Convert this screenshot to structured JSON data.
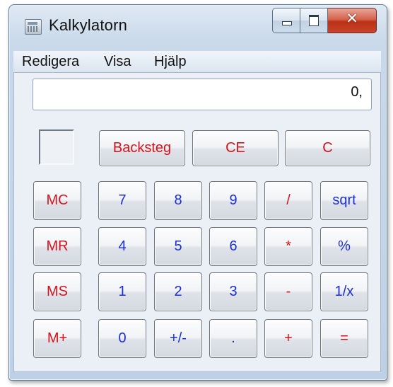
{
  "window": {
    "title": "Kalkylatorn"
  },
  "menu": [
    "Redigera",
    "Visa",
    "Hjälp"
  ],
  "display": {
    "value": "0,"
  },
  "buttons": {
    "backspace": "Backsteg",
    "ce": "CE",
    "c": "C",
    "mc": "MC",
    "mr": "MR",
    "ms": "MS",
    "mplus": "M+",
    "n7": "7",
    "n8": "8",
    "n9": "9",
    "n4": "4",
    "n5": "5",
    "n6": "6",
    "n1": "1",
    "n2": "2",
    "n3": "3",
    "n0": "0",
    "sign": "+/-",
    "dot": ".",
    "div": "/",
    "mul": "*",
    "sub": "-",
    "add": "+",
    "sqrt": "sqrt",
    "pct": "%",
    "recip": "1/x",
    "eq": "="
  },
  "colors": {
    "operator": "#d4141c",
    "digit": "#1b2fd2"
  },
  "icons": [
    "calculator-icon",
    "minimize-icon",
    "maximize-icon",
    "close-icon"
  ]
}
